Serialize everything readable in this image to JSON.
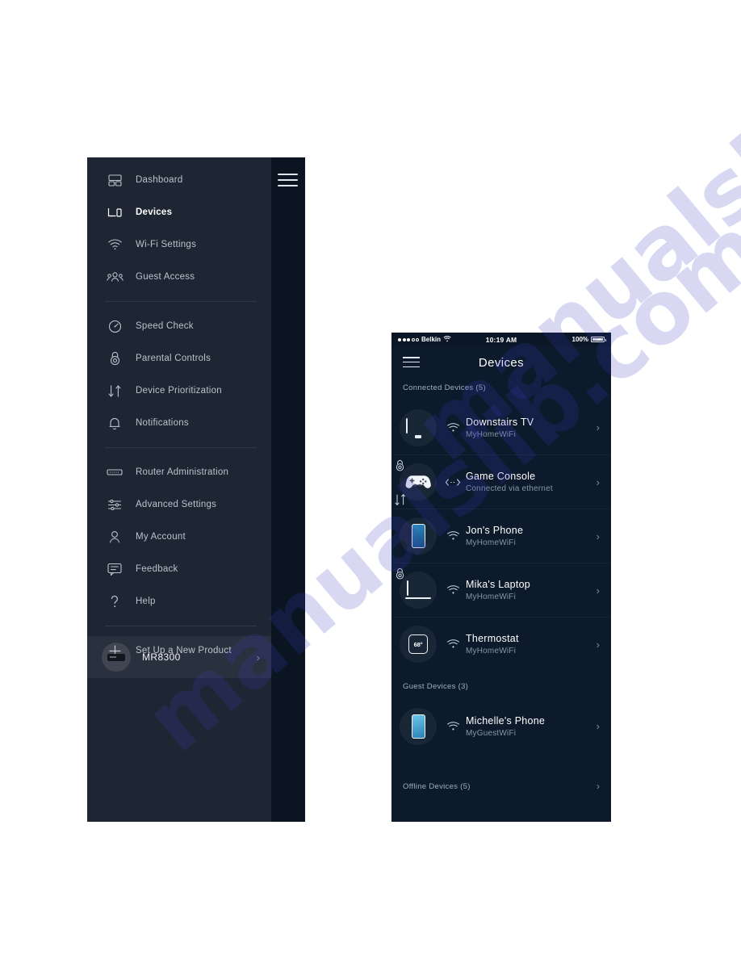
{
  "sidebar": {
    "hamburger_icon": "hamburger-menu-icon",
    "items": [
      {
        "id": "dashboard",
        "label": "Dashboard",
        "icon": "dashboard-icon",
        "active": false
      },
      {
        "id": "devices",
        "label": "Devices",
        "icon": "devices-icon",
        "active": true
      },
      {
        "id": "wifi",
        "label": "Wi-Fi Settings",
        "icon": "wifi-icon",
        "active": false
      },
      {
        "id": "guest",
        "label": "Guest Access",
        "icon": "guest-access-icon",
        "active": false
      },
      {
        "id": "speed",
        "label": "Speed Check",
        "icon": "speedometer-icon",
        "active": false
      },
      {
        "id": "parental",
        "label": "Parental Controls",
        "icon": "lock-icon",
        "active": false
      },
      {
        "id": "priority",
        "label": "Device Prioritization",
        "icon": "up-down-arrows-icon",
        "active": false
      },
      {
        "id": "notify",
        "label": "Notifications",
        "icon": "bell-icon",
        "active": false
      },
      {
        "id": "router",
        "label": "Router Administration",
        "icon": "router-icon",
        "active": false
      },
      {
        "id": "advanced",
        "label": "Advanced Settings",
        "icon": "sliders-icon",
        "active": false
      },
      {
        "id": "account",
        "label": "My Account",
        "icon": "person-icon",
        "active": false
      },
      {
        "id": "feedback",
        "label": "Feedback",
        "icon": "chat-bubble-icon",
        "active": false
      },
      {
        "id": "help",
        "label": "Help",
        "icon": "question-mark-icon",
        "active": false
      },
      {
        "id": "setup",
        "label": "Set Up a New Product",
        "icon": "plus-icon",
        "active": false
      }
    ],
    "current_device": {
      "name": "MR8300",
      "icon": "router-thumbnail-icon",
      "chevron": "›"
    }
  },
  "phone": {
    "status_bar": {
      "carrier": "Belkin",
      "time": "10:19 AM",
      "battery_percent": "100%",
      "wifi_icon": "wifi-icon",
      "signal_icon": "signal-dots-icon",
      "battery_icon": "battery-full-icon"
    },
    "header": {
      "title": "Devices",
      "menu_icon": "hamburger-menu-icon"
    },
    "sections": {
      "connected_label": "Connected Devices (5)",
      "guest_label": "Guest Devices (3)",
      "offline_label": "Offline Devices (5)",
      "chevron": "›"
    },
    "connected_devices": [
      {
        "name": "Downstairs TV",
        "network": "MyHomeWiFi",
        "glyph": "tv-icon",
        "connection": "wifi-icon",
        "lock_badge": false,
        "priority_badge": false
      },
      {
        "name": "Game Console",
        "network": "Connected via ethernet",
        "glyph": "game-controller-icon",
        "connection": "ethernet-icon",
        "lock_badge": true,
        "priority_badge": true
      },
      {
        "name": "Jon's Phone",
        "network": "MyHomeWiFi",
        "glyph": "smartphone-icon",
        "connection": "wifi-icon",
        "lock_badge": false,
        "priority_badge": false
      },
      {
        "name": "Mika's Laptop",
        "network": "MyHomeWiFi",
        "glyph": "laptop-icon",
        "connection": "wifi-icon",
        "lock_badge": true,
        "priority_badge": false
      },
      {
        "name": "Thermostat",
        "network": "MyHomeWiFi",
        "glyph": "thermostat-icon",
        "glyph_text": "68°",
        "connection": "wifi-icon",
        "lock_badge": false,
        "priority_badge": false
      }
    ],
    "guest_devices": [
      {
        "name": "Michelle's Phone",
        "network": "MyGuestWiFi",
        "glyph": "smartphone-icon",
        "connection": "wifi-icon",
        "lock_badge": false,
        "priority_badge": false
      }
    ]
  },
  "watermark": {
    "text": "manualslib.com"
  },
  "colors": {
    "sidebar_menu_bg": "#1e2633",
    "sidebar_rail_bg": "#0b1522",
    "phone_bg": "#0c1a2b",
    "text_primary": "#ffffff",
    "text_muted": "#8696a8",
    "page_bg": "#ffffff"
  }
}
